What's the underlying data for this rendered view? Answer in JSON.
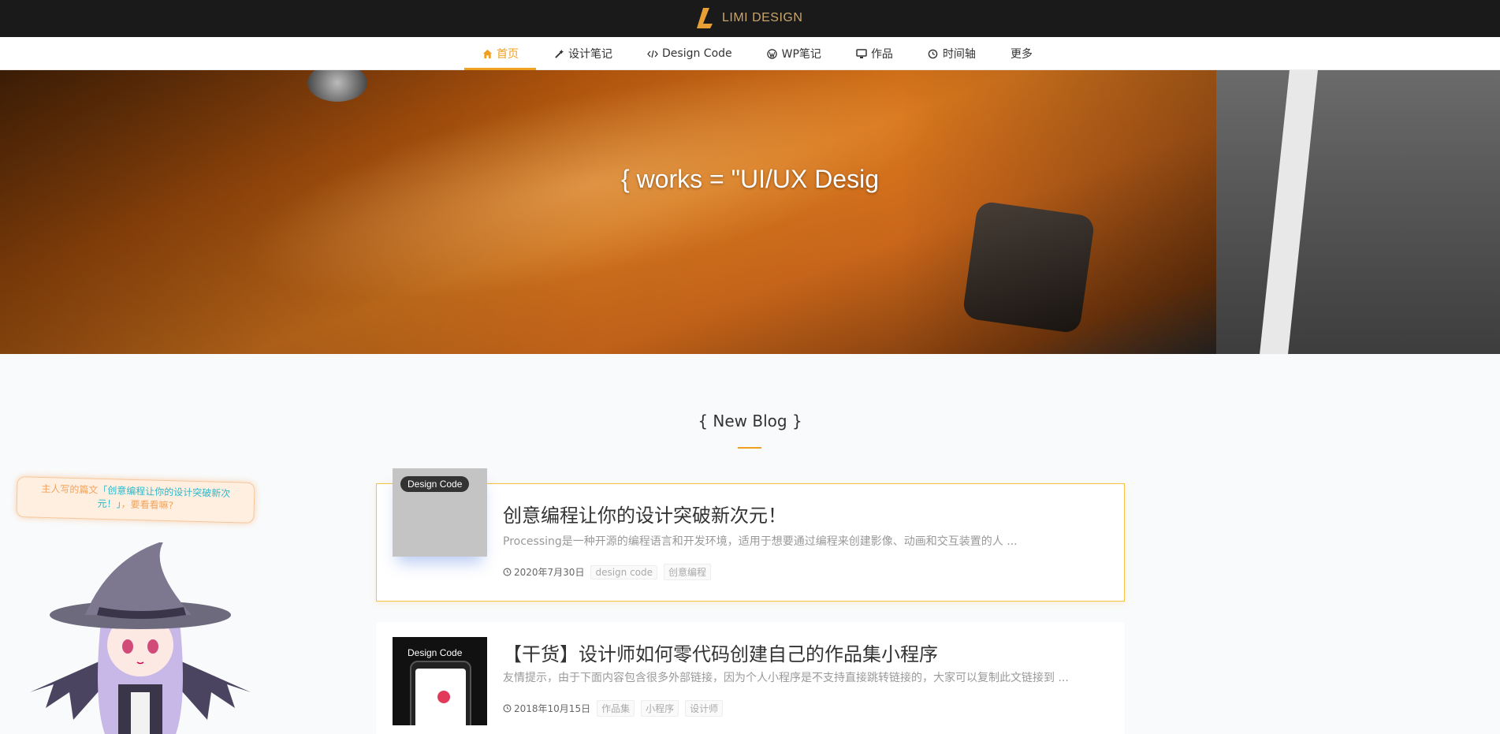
{
  "brand": {
    "name": "LIMI DESIGN"
  },
  "nav": {
    "items": [
      {
        "label": "首页",
        "icon": "home-icon",
        "active": true
      },
      {
        "label": "设计笔记",
        "icon": "magic-wand-icon",
        "active": false
      },
      {
        "label": "Design Code",
        "icon": "code-icon",
        "active": false
      },
      {
        "label": "WP笔记",
        "icon": "wordpress-icon",
        "active": false
      },
      {
        "label": "作品",
        "icon": "desktop-icon",
        "active": false
      },
      {
        "label": "时间轴",
        "icon": "clock-icon",
        "active": false
      },
      {
        "label": "更多",
        "icon": "",
        "active": false
      }
    ]
  },
  "hero": {
    "title": "{ works = \"UI/UX Desig"
  },
  "section": {
    "title": "{ New Blog }"
  },
  "posts": [
    {
      "tag": "Design Code",
      "title": "创意编程让你的设计突破新次元！",
      "excerpt": "Processing是一种开源的编程语言和开发环境，适用于想要通过编程来创建影像、动画和交互装置的人 ...",
      "date": "2020年7月30日",
      "tags": [
        "design code",
        "创意编程"
      ]
    },
    {
      "tag": "Design Code",
      "title": "【干货】设计师如何零代码创建自己的作品集小程序",
      "excerpt": "友情提示，由于下面内容包含很多外部链接，因为个人小程序是不支持直接跳转链接的，大家可以复制此文链接到 ...",
      "date": "2018年10月15日",
      "tags": [
        "作品集",
        "小程序",
        "设计师"
      ]
    }
  ],
  "mascot": {
    "bubble_prefix": "主人写的篇文",
    "bubble_link": "「创意编程让你的设计突破新次元！」",
    "bubble_suffix": "，要看看嘛?"
  },
  "colors": {
    "accent": "#f0a020",
    "topbar": "#1a1a1a",
    "link": "#2bb7c8"
  }
}
